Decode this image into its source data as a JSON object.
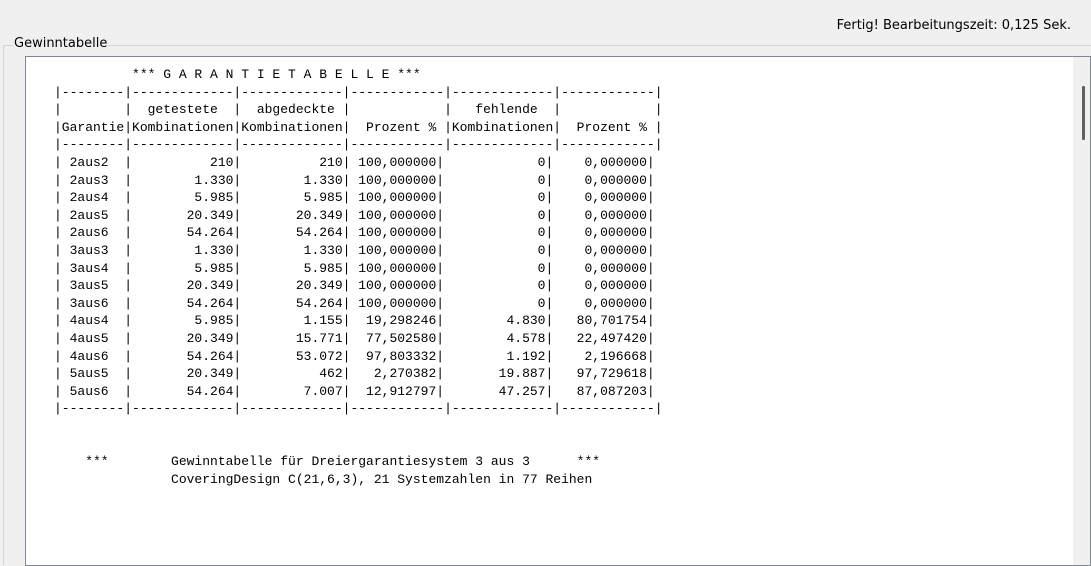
{
  "status": {
    "text": "Fertig! Bearbeitungszeit: 0,125 Sek."
  },
  "group": {
    "title": "Gewinntabelle"
  },
  "report": {
    "lines": [
      "          *** G A R A N T I E T A B E L L E ***",
      "|--------|-------------|-------------|------------|-------------|------------|",
      "|        |  getestete  |  abgedeckte |            |   fehlende  |            |",
      "|Garantie|Kombinationen|Kombinationen|  Prozent % |Kombinationen|  Prozent % |",
      "|--------|-------------|-------------|------------|-------------|------------|",
      "| 2aus2  |          210|          210| 100,000000|            0|    0,000000|",
      "| 2aus3  |        1.330|        1.330| 100,000000|            0|    0,000000|",
      "| 2aus4  |        5.985|        5.985| 100,000000|            0|    0,000000|",
      "| 2aus5  |       20.349|       20.349| 100,000000|            0|    0,000000|",
      "| 2aus6  |       54.264|       54.264| 100,000000|            0|    0,000000|",
      "| 3aus3  |        1.330|        1.330| 100,000000|            0|    0,000000|",
      "| 3aus4  |        5.985|        5.985| 100,000000|            0|    0,000000|",
      "| 3aus5  |       20.349|       20.349| 100,000000|            0|    0,000000|",
      "| 3aus6  |       54.264|       54.264| 100,000000|            0|    0,000000|",
      "| 4aus4  |        5.985|        1.155|  19,298246|        4.830|   80,701754|",
      "| 4aus5  |       20.349|       15.771|  77,502580|        4.578|   22,497420|",
      "| 4aus6  |       54.264|       53.072|  97,803332|        1.192|    2,196668|",
      "| 5aus5  |       20.349|          462|   2,270382|       19.887|   97,729618|",
      "| 5aus6  |       54.264|        7.007|  12,912797|       47.257|   87,087203|",
      "|--------|-------------|-------------|------------|-------------|------------|",
      "",
      "",
      "    ***        Gewinntabelle für Dreiergarantiesystem 3 aus 3      ***",
      "               CoveringDesign C(21,6,3), 21 Systemzahlen in 77 Reihen"
    ]
  }
}
